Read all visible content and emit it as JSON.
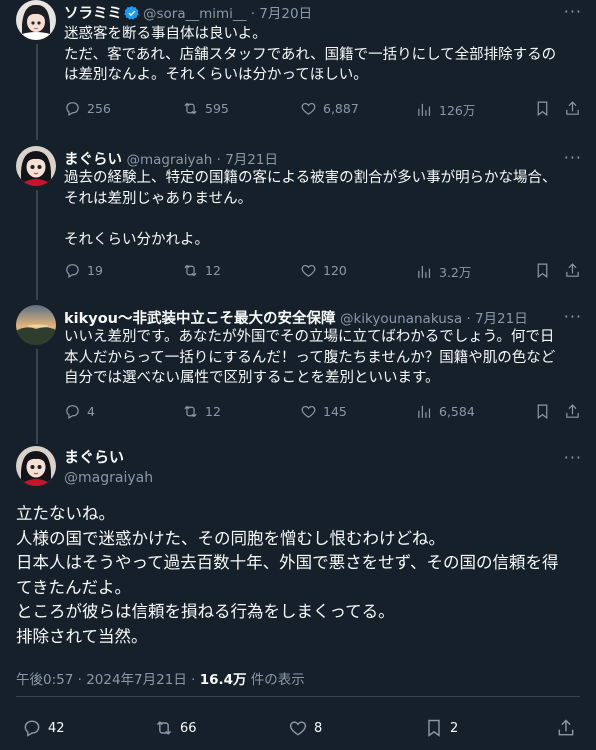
{
  "tweets": [
    {
      "name": "ソラミミ",
      "handle": "@sora__mimi__",
      "date": "7月20日",
      "verified": true,
      "lines": [
        "迷惑客を断る事自体は良いよ。",
        "ただ、客であれ、店舗スタッフであれ、国籍で一括りにして全部排除するの",
        "は差別なんよ。それくらいは分かってほしい。"
      ],
      "replies": "256",
      "retweets": "595",
      "likes": "6,887",
      "views": "126万"
    },
    {
      "name": "まぐらい",
      "handle": "@magraiyah",
      "date": "7月21日",
      "lines": [
        "過去の経験上、特定の国籍の客による被害の割合が多い事が明らかな場合、",
        "それは差別じゃありません。",
        "",
        "それくらい分かれよ。"
      ],
      "replies": "19",
      "retweets": "12",
      "likes": "120",
      "views": "3.2万"
    },
    {
      "name": "kikyou〜非武装中立こそ最大の安全保障",
      "handle": "@kikyounanakusa",
      "date": "7月21日",
      "lines": [
        "いいえ差別です。あなたが外国でその立場に立てばわかるでしょう。何で日",
        "本人だからって一括りにするんだ！って腹たちませんか？国籍や肌の色など",
        "自分では選べない属性で区別することを差別といいます。"
      ],
      "replies": "4",
      "retweets": "12",
      "likes": "145",
      "views": "6,584"
    }
  ],
  "main": {
    "name": "まぐらい",
    "handle": "@magraiyah",
    "lines": [
      "立たないね。",
      "人様の国で迷惑かけた、その同胞を憎むし恨むわけどね。",
      "日本人はそうやって過去百数十年、外国で悪さをせず、その国の信頼を得",
      "てきたんだよ。",
      "ところが彼らは信頼を損ねる行為をしまくってる。",
      "排除されて当然。"
    ],
    "time": "午後0:57 · 2024年7月21日 · ",
    "views_count": "16.4万",
    "views_label": " 件の表示",
    "replies": "42",
    "retweets": "66",
    "likes": "8",
    "bookmarks": "2"
  },
  "more_label": "···"
}
